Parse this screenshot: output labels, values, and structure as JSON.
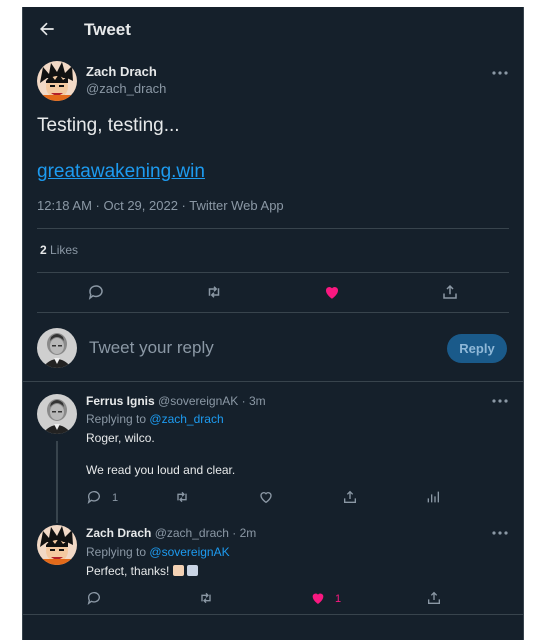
{
  "header": {
    "title": "Tweet"
  },
  "main_tweet": {
    "author_name": "Zach Drach",
    "author_handle": "@zach_drach",
    "text": "Testing, testing...",
    "url": "greatawakening.win",
    "timestamp": "12:18 AM · Oct 29, 2022",
    "separator": " · ",
    "source": "Twitter Web App",
    "likes_count": "2",
    "likes_label": "Likes",
    "liked": true
  },
  "reply_box": {
    "placeholder": "Tweet your reply",
    "button_label": "Reply"
  },
  "replies": [
    {
      "author_name": "Ferrus Ignis",
      "author_handle": "@sovereignAK",
      "time": "· 3m",
      "replying_prefix": "Replying to",
      "replying_to": "@zach_drach",
      "line1": "Roger, wilco.",
      "line2": "We read you loud and clear.",
      "reply_count": "1"
    },
    {
      "author_name": "Zach Drach",
      "author_handle": "@zach_drach",
      "time": "· 2m",
      "replying_prefix": "Replying to",
      "replying_to": "@sovereignAK",
      "text": "Perfect, thanks!",
      "like_count": "1",
      "emoji": [
        "thumbs-up",
        "folded-hands"
      ]
    }
  ],
  "colors": {
    "background": "#15202b",
    "border": "#38444d",
    "link": "#1d9bf0",
    "like": "#f91880",
    "muted": "#8b98a5"
  }
}
